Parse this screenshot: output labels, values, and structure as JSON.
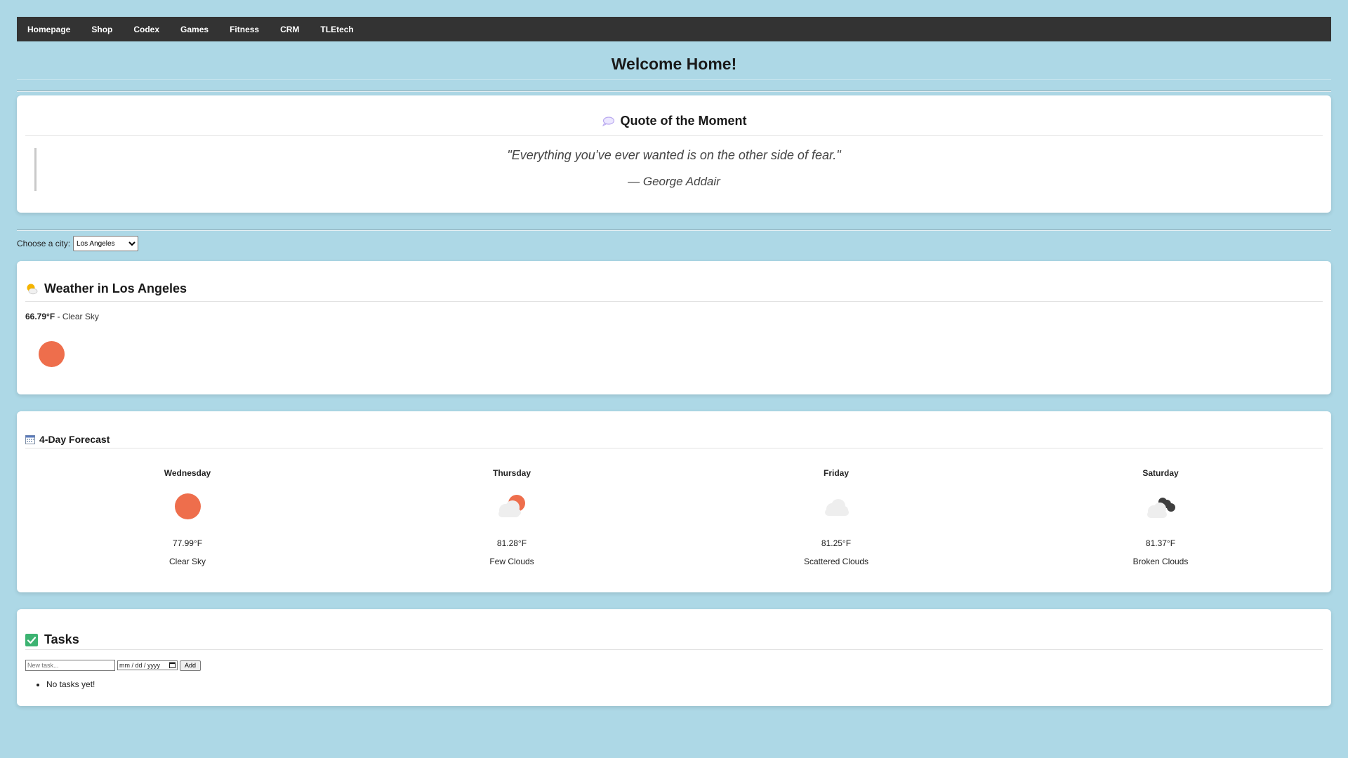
{
  "nav": {
    "items": [
      "Homepage",
      "Shop",
      "Codex",
      "Games",
      "Fitness",
      "CRM",
      "TLEtech"
    ]
  },
  "page": {
    "title": "Welcome Home!"
  },
  "quote": {
    "heading": "Quote of the Moment",
    "icon": "speech-bubble-icon",
    "text": "\"Everything you’ve ever wanted is on the other side of fear.\"",
    "author": "— George Addair"
  },
  "city": {
    "label": "Choose a city:",
    "selected": "Los Angeles"
  },
  "weather": {
    "heading": "Weather in Los Angeles",
    "icon": "sun-behind-cloud-icon",
    "temp": "66.79°F",
    "condition": " - Clear Sky",
    "condition_icon": "sun-icon",
    "sun_color": "#ee6e4c"
  },
  "forecast": {
    "heading": "4-Day Forecast",
    "icon": "calendar-icon",
    "days": [
      {
        "name": "Wednesday",
        "temp": "77.99°F",
        "desc": "Clear Sky",
        "icon": "sun-icon"
      },
      {
        "name": "Thursday",
        "temp": "81.28°F",
        "desc": "Few Clouds",
        "icon": "sun-cloud-icon"
      },
      {
        "name": "Friday",
        "temp": "81.25°F",
        "desc": "Scattered Clouds",
        "icon": "cloud-icon"
      },
      {
        "name": "Saturday",
        "temp": "81.37°F",
        "desc": "Broken Clouds",
        "icon": "dark-clouds-icon"
      }
    ]
  },
  "tasks": {
    "heading": "Tasks",
    "icon": "check-mark-icon",
    "input_placeholder": "New task...",
    "date_placeholder": "mm / dd / yyyy",
    "add_label": "Add",
    "empty_text": "No tasks yet!"
  },
  "colors": {
    "background": "#add8e6",
    "navbar": "#333333",
    "accent_sun": "#ee6e4c"
  }
}
